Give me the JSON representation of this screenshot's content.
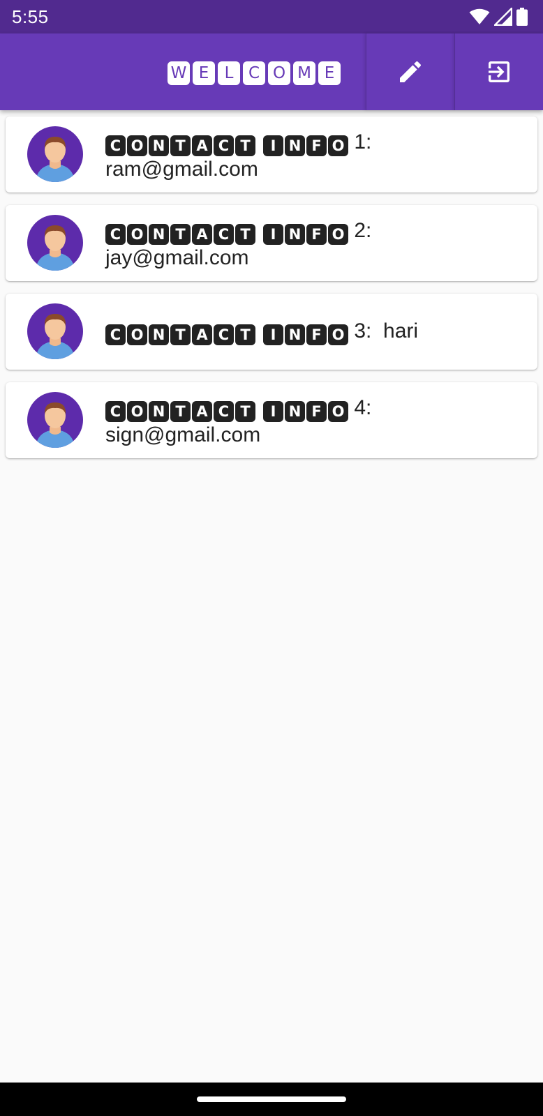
{
  "status_bar": {
    "time": "5:55",
    "icons": [
      "wifi-icon",
      "signal-icon",
      "battery-icon"
    ]
  },
  "app_bar": {
    "title": "WELCOME",
    "actions": [
      "edit-icon",
      "logout-icon"
    ],
    "colors": {
      "background": "#673ab7",
      "status_bar": "#512a8f"
    }
  },
  "contacts": [
    {
      "label": "CONTACT INFO",
      "suffix": "1:",
      "value": "ram@gmail.com"
    },
    {
      "label": "CONTACT INFO",
      "suffix": "2:",
      "value": "jay@gmail.com"
    },
    {
      "label": "CONTACT INFO",
      "suffix": "3:",
      "value": "hari"
    },
    {
      "label": "CONTACT INFO",
      "suffix": "4:",
      "value": "sign@gmail.com"
    }
  ]
}
